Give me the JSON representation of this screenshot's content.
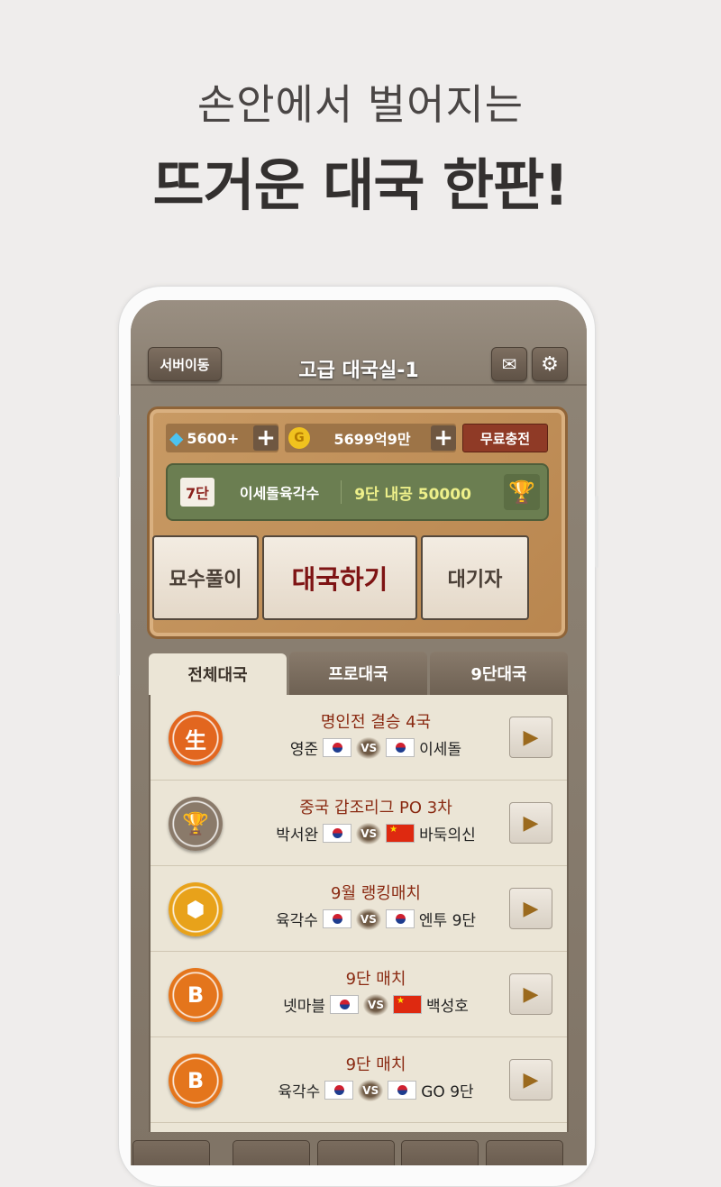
{
  "headline": {
    "line1": "손안에서 벌어지는",
    "line2": "뜨거운 대국 한판!"
  },
  "topbar": {
    "server_button": "서버이동",
    "title": "고급 대국실-1",
    "mail_icon": "envelope-icon",
    "settings_icon": "gear-icon"
  },
  "resources": {
    "diamonds": "5600+",
    "gold": "5699억9만",
    "free_charge": "무료충전",
    "plus": "+"
  },
  "profile": {
    "rank": "7단",
    "name": "이세돌육각수",
    "goal": "9단 내공 50000"
  },
  "actions": {
    "puzzle": "묘수풀이",
    "play": "대국하기",
    "waiting": "대기자"
  },
  "tabs": [
    {
      "label": "전체대국",
      "active": true
    },
    {
      "label": "프로대국",
      "active": false
    },
    {
      "label": "9단대국",
      "active": false
    }
  ],
  "matches": [
    {
      "title": "명인전 결승 4국",
      "p1": "영준",
      "f1": "kr",
      "p2": "이세돌",
      "f2": "kr",
      "icon": "生",
      "icon_color": "#e2661f"
    },
    {
      "title": "중국 갑조리그 PO 3차",
      "p1": "박서완",
      "f1": "kr",
      "p2": "바둑의신",
      "f2": "cn",
      "icon": "🏆",
      "icon_color": "#8a7a6a"
    },
    {
      "title": "9월 랭킹매치",
      "p1": "육각수",
      "f1": "kr",
      "p2": "엔투 9단",
      "f2": "kr",
      "icon": "⬢",
      "icon_color": "#e8a21a"
    },
    {
      "title": "9단 매치",
      "p1": "넷마블",
      "f1": "kr",
      "p2": "백성호",
      "f2": "cn",
      "icon": "B",
      "icon_color": "#e4751c"
    },
    {
      "title": "9단 매치",
      "p1": "육각수",
      "f1": "kr",
      "p2": "GO 9단",
      "f2": "kr",
      "icon": "B",
      "icon_color": "#e4751c"
    }
  ],
  "vs": "VS",
  "play_icon": "▶"
}
